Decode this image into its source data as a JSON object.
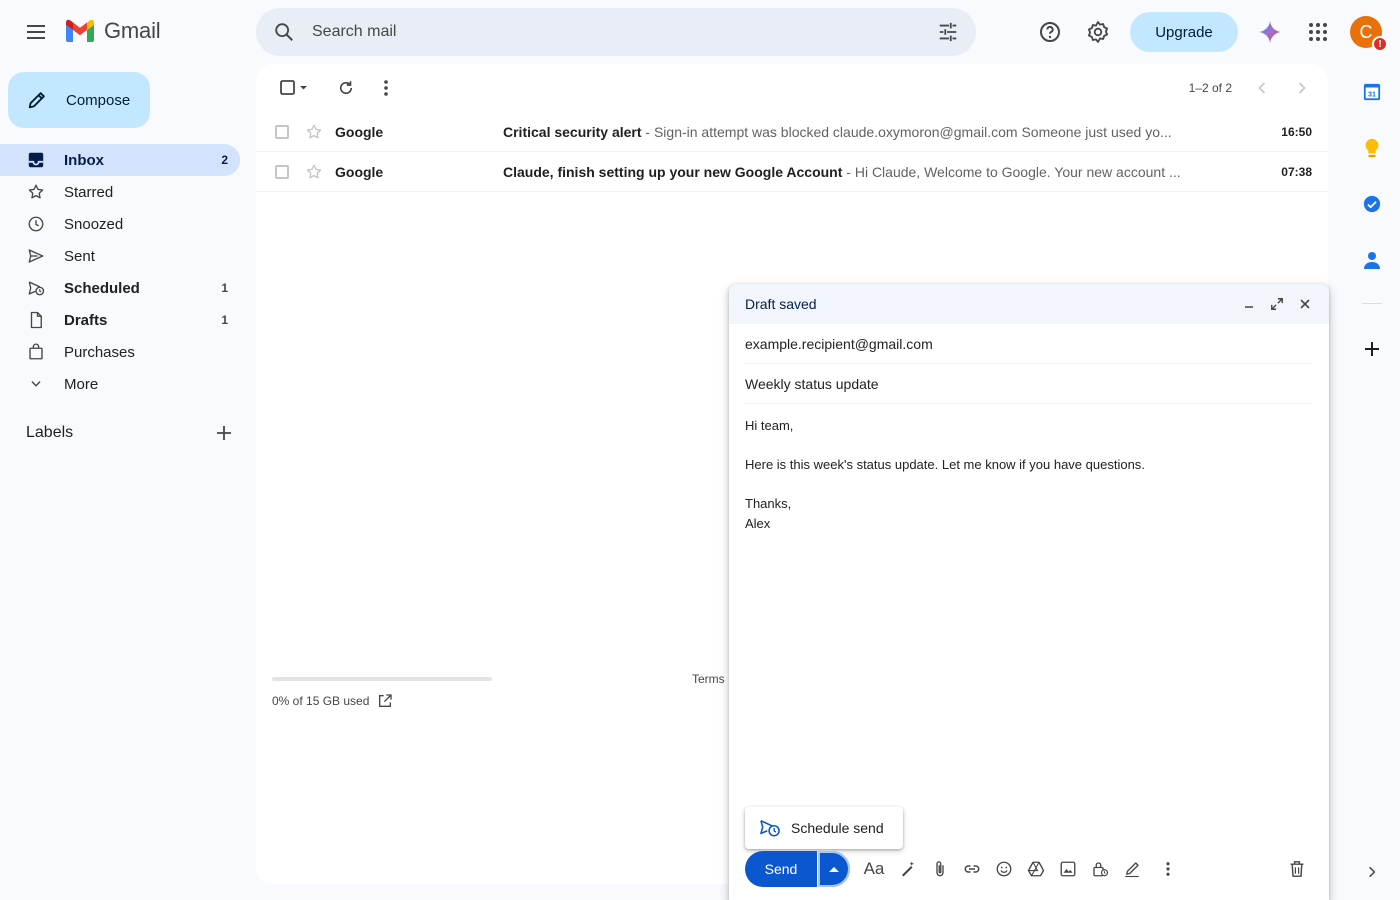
{
  "app": {
    "name": "Gmail"
  },
  "header": {
    "search_placeholder": "Search mail",
    "upgrade_label": "Upgrade",
    "avatar_letter": "C",
    "avatar_badge": "!"
  },
  "sidebar": {
    "compose_label": "Compose",
    "items": [
      {
        "label": "Inbox",
        "count": "2",
        "icon": "inbox-icon"
      },
      {
        "label": "Starred",
        "count": "",
        "icon": "star-icon"
      },
      {
        "label": "Snoozed",
        "count": "",
        "icon": "clock-icon"
      },
      {
        "label": "Sent",
        "count": "",
        "icon": "send-icon"
      },
      {
        "label": "Scheduled",
        "count": "1",
        "icon": "scheduled-icon"
      },
      {
        "label": "Drafts",
        "count": "1",
        "icon": "draft-icon"
      },
      {
        "label": "Purchases",
        "count": "",
        "icon": "bag-icon"
      },
      {
        "label": "More",
        "count": "",
        "icon": "chevron-down-icon"
      }
    ],
    "labels_heading": "Labels"
  },
  "mail_list": {
    "range": "1–2 of 2",
    "rows": [
      {
        "sender": "Google",
        "subject": "Critical security alert",
        "snippet": " - Sign-in attempt was blocked claude.oxymoron@gmail.com Someone just used yo...",
        "time": "16:50"
      },
      {
        "sender": "Google",
        "subject": "Claude, finish setting up your new Google Account",
        "snippet": " - Hi Claude, Welcome to Google. Your new account ...",
        "time": "07:38"
      }
    ]
  },
  "footer": {
    "storage_text": "0% of 15 GB used",
    "storage_fraction": 0,
    "terms": "Terms"
  },
  "compose_window": {
    "title": "Draft saved",
    "to": "example.recipient@gmail.com",
    "subject": "Weekly status update",
    "body_lines": [
      "Hi team,",
      "",
      "Here is this week's status update. Let me know if you have questions.",
      "",
      "Thanks,",
      "Alex"
    ],
    "schedule_send_label": "Schedule send",
    "send_label": "Send",
    "format_label": "Aa"
  },
  "colors": {
    "accent": "#0b57d0",
    "compose_bg": "#c2e7ff",
    "active_nav": "#d3e3fd",
    "avatar": "#e8710a"
  }
}
